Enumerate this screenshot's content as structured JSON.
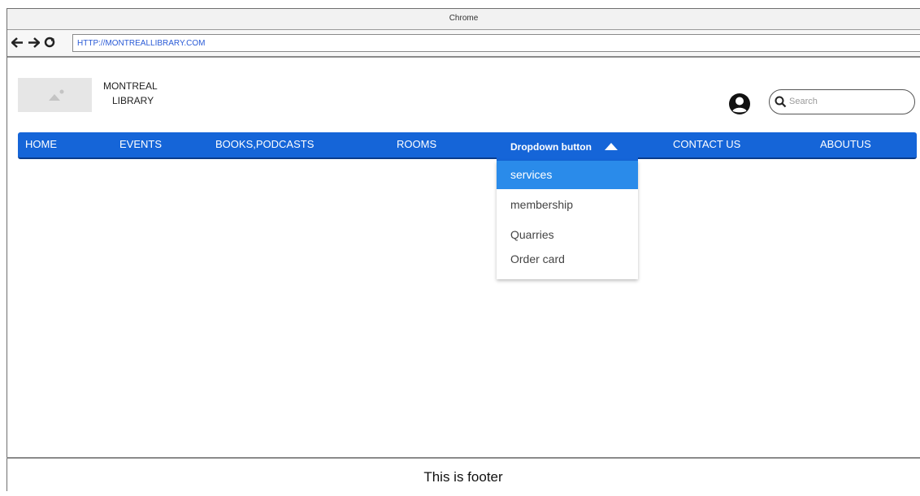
{
  "browser": {
    "title": "Chrome",
    "url": "HTTP://MONTREALLIBRARY.COM",
    "icons": [
      "back-arrow-icon",
      "forward-arrow-icon",
      "reload-icon"
    ]
  },
  "header": {
    "brand_line1": "MONTREAL",
    "brand_line2": "LIBRARY",
    "search_placeholder": "Search"
  },
  "nav": {
    "items": [
      "HOME",
      "EVENTS",
      "BOOKS,PODCASTS",
      "ROOMS",
      "CONTACT US",
      "ABOUTUS"
    ],
    "dropdown_label": "Dropdown button",
    "dropdown_items": [
      "services",
      "membership",
      "Quarries",
      "Order card"
    ],
    "active_dropdown_item": "services"
  },
  "footer": {
    "text": "This is footer"
  },
  "colors": {
    "nav_bg": "#1565d8",
    "active_item_bg": "#2a8bea",
    "url_text": "#2a5bd7"
  }
}
